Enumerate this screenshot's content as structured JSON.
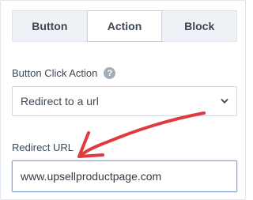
{
  "tabs": [
    {
      "label": "Button",
      "active": false
    },
    {
      "label": "Action",
      "active": true
    },
    {
      "label": "Block",
      "active": false
    }
  ],
  "click_action": {
    "label": "Button Click Action",
    "help_icon": "question-circle-icon",
    "help_glyph": "?",
    "selected_value": "Redirect to a url",
    "dropdown_icon": "chevron-down-icon"
  },
  "redirect_url": {
    "label": "Redirect URL",
    "value": "www.upsellproductpage.com"
  },
  "annotation": {
    "icon": "red-hand-drawn-arrow",
    "color": "#e0393e"
  }
}
